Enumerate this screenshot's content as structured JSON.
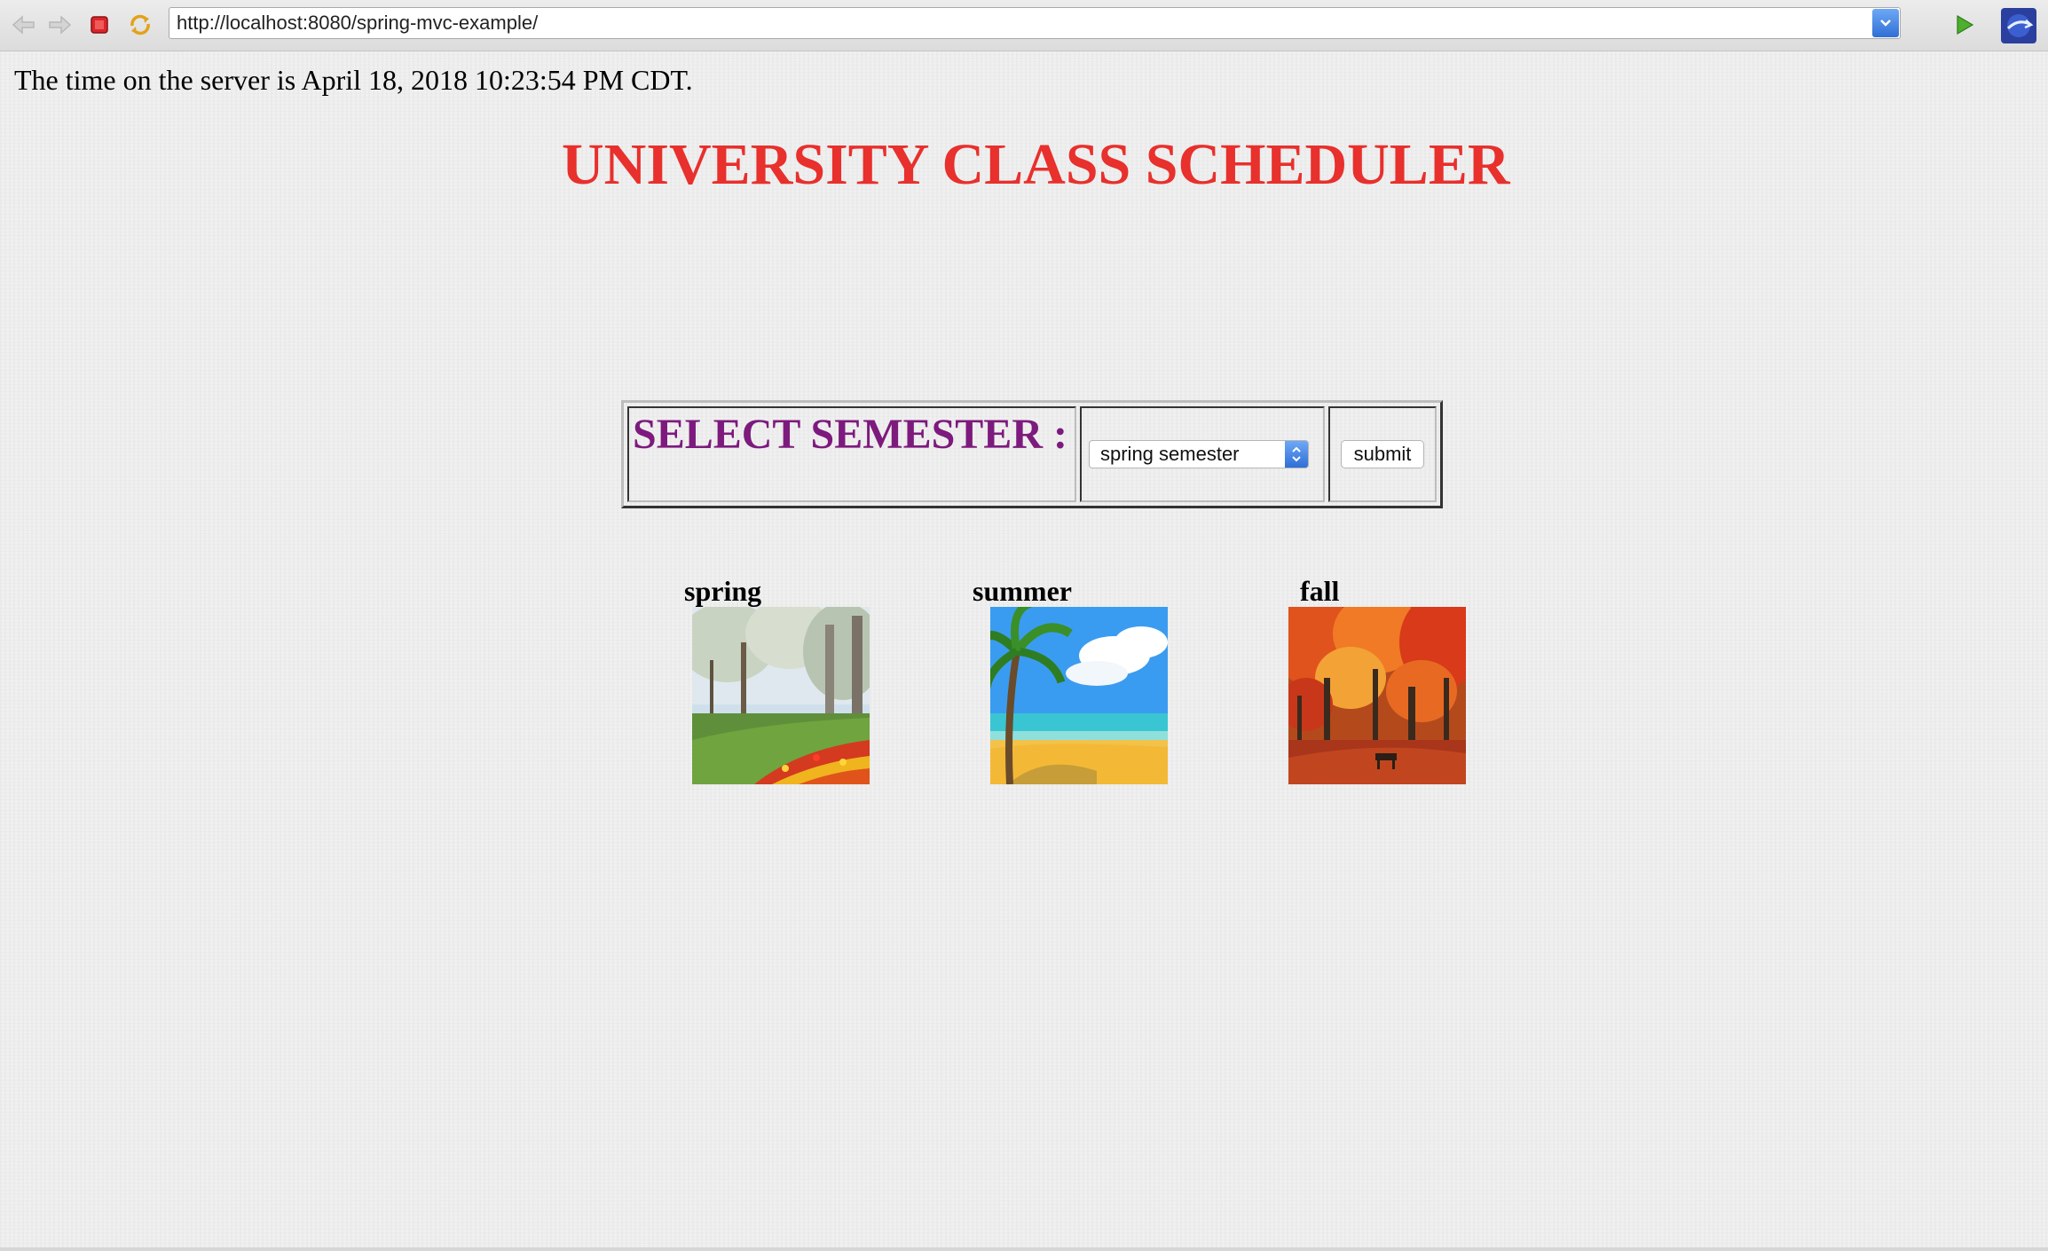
{
  "browser": {
    "url": "http://localhost:8080/spring-mvc-example/",
    "icons": {
      "back": "back-arrow-icon",
      "forward": "forward-arrow-icon",
      "stop": "stop-icon",
      "refresh": "refresh-icon",
      "go": "go-play-icon",
      "extension": "browser-extension-icon"
    }
  },
  "page": {
    "server_time": "The time on the server is April 18, 2018 10:23:54 PM CDT.",
    "title": "UNIVERSITY CLASS SCHEDULER",
    "title_color": "#e8302c",
    "label_color": "#7d1a7d"
  },
  "form": {
    "select_label": "SELECT SEMESTER :",
    "selected_semester": "spring semester",
    "submit_label": "submit"
  },
  "seasons": [
    {
      "label": "spring",
      "image": "spring-park-tulips-image"
    },
    {
      "label": "summer",
      "image": "summer-beach-palm-image"
    },
    {
      "label": "fall",
      "image": "fall-autumn-trees-image"
    }
  ]
}
